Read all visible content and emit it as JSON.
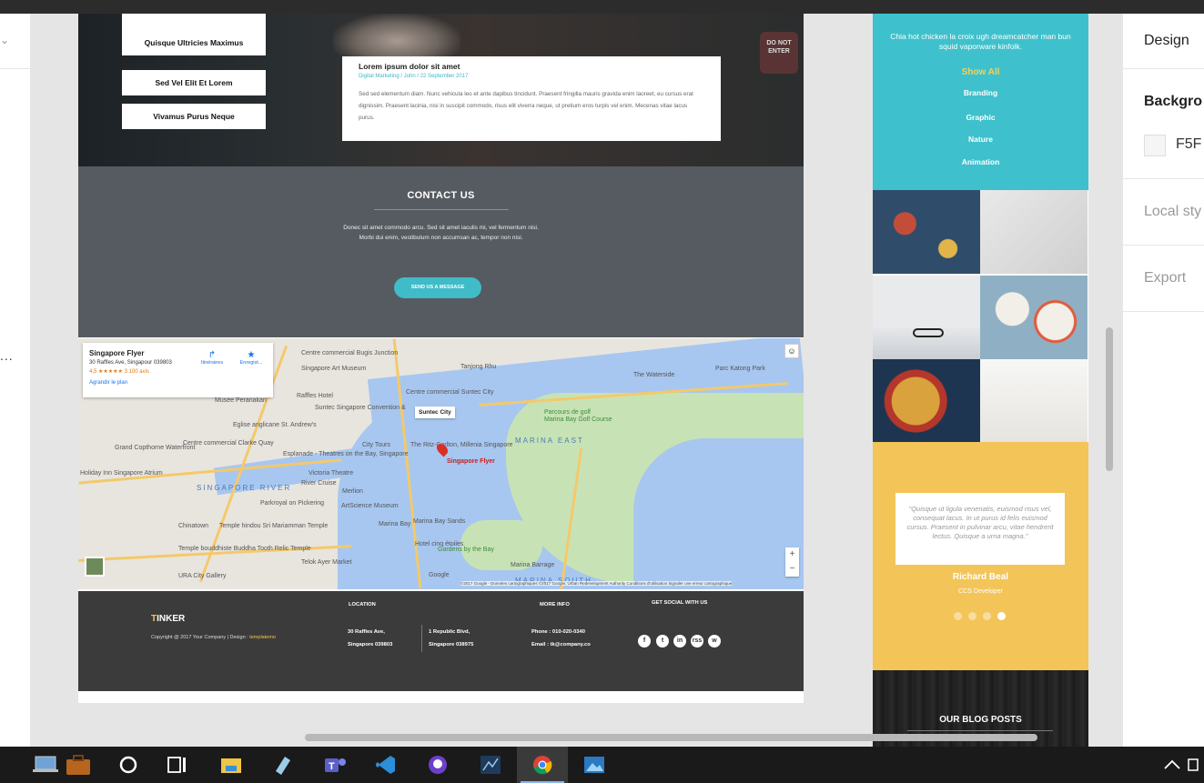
{
  "colors": {
    "teal": "#3ec1cc",
    "yellow": "#f3c558",
    "footer": "#3b3b3b",
    "contact": "#555b61"
  },
  "left_panel": {
    "ellipsis": "..."
  },
  "hero": {
    "sign_text": "DO NOT ENTER",
    "categories": [
      "Quisque Ultricies Maximus",
      "Sed Vel Elit Et Lorem",
      "Vivamus Purus Neque"
    ],
    "card": {
      "title": "Lorem ipsum dolor sit amet",
      "meta": "Digital Marketing / John / 22 September 2017",
      "body": "Sed sed elementum diam. Nunc vehicula leo et ante dapibus tincidunt. Praesent fringilla mauris gravida enim laoreet, eu cursus erat dignissim. Praesent lacinia, nisi in suscipit commodo, risus elit viverra neque, ut pretium eros turpis vel enim. Mecenas vitae lacus purus."
    }
  },
  "contact": {
    "title": "CONTACT US",
    "text": "Donec sit amet commodo arcu. Sed sit amet iaculis mi, vel fermentum nisi. Morbi dui enim, vestibulum non accumsan ac, tempor non nisi.",
    "button": "SEND US A MESSAGE"
  },
  "map": {
    "place": "Singapore Flyer",
    "address": "30 Raffles Ave, Singapour 039803",
    "rating": "4,5 ★★★★★  3 100 avis",
    "enlarge": "Agrandir le plan",
    "directions": "Itinéraires",
    "save": "Enregist...",
    "tooltip": "Suntec City",
    "pin_label": "Singapore Flyer",
    "attribution": "©2017 Google - Données cartographiques ©2017 Google, Urban Redevelopment Authority   Conditions d'utilisation   Signaler une erreur cartographique",
    "zoom_in": "+",
    "zoom_out": "−",
    "labels": [
      "Centre commercial Bugis Junction",
      "Singapore Art Museum",
      "Raffles Hotel",
      "Musée Peranakan",
      "Suntec Singapore Convention &",
      "Centre commercial Suntec City",
      "Tanjong Rhu",
      "The Waterside",
      "Parc Katong Park",
      "Marina Bay Golf Course",
      "Parcours de golf",
      "Esplanade - Theatres on the Bay, Singapore",
      "City Tours",
      "Victoria Theatre",
      "Merlion",
      "ArtScience Museum",
      "River Cruise",
      "Parkroyal on Pickering",
      "Marina Bay",
      "Marina Bay Sands",
      "Gardens by the Bay",
      "Marina Barrage",
      "Telok Ayer Market",
      "URA City Gallery",
      "Temple bouddhiste Buddha Tooth Relic Temple",
      "Grand Copthorne Waterfront",
      "Holiday Inn Singapore Atrium",
      "Chinatown",
      "Temple hindou Sri Mariamman Temple",
      "Centre commercial Clarke Quay",
      "Eglise anglicane St. Andrew's",
      "The Ritz-Carlton, Millenia Singapore",
      "Hotel cinq étoiles",
      "Google"
    ],
    "water_labels": [
      "SINGAPORE RIVER",
      "MARINA EAST",
      "MARINA SOUTH"
    ]
  },
  "footer": {
    "brand_first": "T",
    "brand_rest": "INKER",
    "copyright": "Copyright @ 2017 Your Company | Design : ",
    "design_link": "templatemo",
    "location_title": "LOCATION",
    "addr1": [
      "30 Raffles Ave,",
      "Singapore 039803"
    ],
    "addr2": [
      "1 Republic Blvd,",
      "Singapore 038975"
    ],
    "more_title": "MORE INFO",
    "phone": "Phone : 010-020-0340",
    "email": "Email : tk@company.co",
    "social_title": "GET SOCIAL WITH US",
    "social_icons": [
      "f",
      "t",
      "in",
      "rss",
      "w"
    ]
  },
  "portfolio": {
    "intro": "Chia hot chicken la croix ugh dreamcatcher man bun squid vaporware kinfolk.",
    "show_all": "Show All",
    "filters": [
      "Branding",
      "Graphic",
      "Nature",
      "Animation"
    ]
  },
  "testimonial": {
    "quote": "\"Quisque ut ligula venenatis, euismod risus vel, consequat lacus. In ut purus id felis euismod cursus. Praesent in pulvinar arcu, vitae hendrerit lectus. Quisque a urna magna.\"",
    "name": "Richard  Beal",
    "role": "CCS Developer",
    "slides": 4,
    "active_slide": 4
  },
  "blog": {
    "title": "OUR BLOG POSTS"
  },
  "design_panel": {
    "tab": "Design",
    "background_label": "Backgro",
    "background_value": "F5F",
    "local_styles": "Local sty",
    "export": "Export"
  },
  "taskbar": {
    "apps": [
      "laptop-icon",
      "briefcase-icon",
      "cortana-icon",
      "task-view-icon",
      "file-explorer-icon",
      "notepad-icon",
      "teams-icon",
      "vscode-icon",
      "github-icon",
      "sourcetree-icon",
      "chrome-icon",
      "photos-icon"
    ],
    "active": "chrome-icon"
  }
}
